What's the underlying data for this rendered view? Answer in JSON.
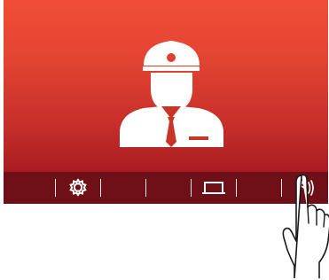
{
  "screen": {
    "video": {
      "content": "visitor-silhouette",
      "colors": {
        "bg_top": "#f14d36",
        "bg_bottom": "#a81c22",
        "figure": "#ffffff"
      }
    },
    "toolbar": {
      "background": "#6f0f17",
      "buttons": [
        {
          "name": "blank-left",
          "icon": "none"
        },
        {
          "name": "settings",
          "icon": "gear-icon"
        },
        {
          "name": "blank-2",
          "icon": "none"
        },
        {
          "name": "blank-3",
          "icon": "none"
        },
        {
          "name": "screen-off",
          "icon": "monitor-icon"
        },
        {
          "name": "blank-4",
          "icon": "none"
        },
        {
          "name": "talk",
          "icon": "talk-sound-icon"
        }
      ]
    }
  },
  "overlay": {
    "pointer": "pointing-hand-icon"
  }
}
